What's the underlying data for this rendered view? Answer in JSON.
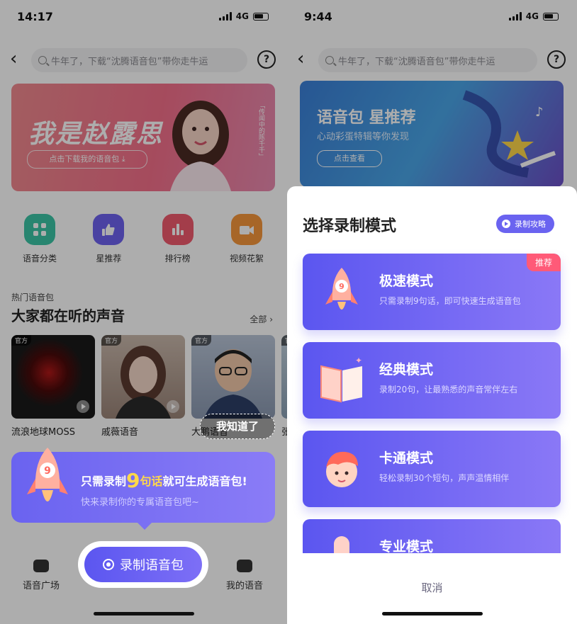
{
  "left": {
    "status": {
      "time": "14:17",
      "network": "4G"
    },
    "search_placeholder": "牛年了，下载“沈腾语音包”带你走牛运",
    "help": "?",
    "banner": {
      "title": "我是赵露思",
      "button": "点击下载我的语音包 ⤓",
      "side_text": "「传闻中的陈千千」"
    },
    "categories": [
      {
        "label": "语音分类",
        "icon": "grid-icon",
        "color": "#3cc4a6"
      },
      {
        "label": "星推荐",
        "icon": "thumbs-up-icon",
        "color": "#6e62ef"
      },
      {
        "label": "排行榜",
        "icon": "ranking-icon",
        "color": "#f05a6e"
      },
      {
        "label": "视频花絮",
        "icon": "video-icon",
        "color": "#f7973c"
      }
    ],
    "section_sub": "热门语音包",
    "section_title": "大家都在听的声音",
    "view_all": "全部 ›",
    "cards": [
      {
        "name": "流浪地球MOSS",
        "tag": "官方"
      },
      {
        "name": "戚薇语音",
        "tag": "官方"
      },
      {
        "name": "大鹏语音",
        "tag": "官方"
      },
      {
        "name": "张",
        "tag": "官方"
      }
    ],
    "i_know": "我知道了",
    "tip": {
      "pre": "只需录制",
      "num": "9",
      "mid": "句话",
      "post": "就可生成语音包!",
      "sub": "快来录制你的专属语音包吧~"
    },
    "tabs": {
      "square": "语音广场",
      "record": "录制语音包",
      "mine": "我的语音"
    }
  },
  "right": {
    "status": {
      "time": "9:44",
      "network": "4G"
    },
    "search_placeholder": "牛年了，下载“沈腾语音包”带你走牛运",
    "help": "?",
    "banner": {
      "title": "语音包 星推荐",
      "subtitle": "心动彩蛋特辑等你发现",
      "button": "点击查看"
    },
    "sheet": {
      "title": "选择录制模式",
      "guide": "录制攻略",
      "modes": [
        {
          "title": "极速模式",
          "desc": "只需录制9句话，即可快速生成语音包",
          "badge": "推荐",
          "icon": "rocket-icon"
        },
        {
          "title": "经典模式",
          "desc": "录制20句，让最熟悉的声音常伴左右",
          "badge": "",
          "icon": "book-icon"
        },
        {
          "title": "卡通模式",
          "desc": "轻松录制30个短句，声声温情相伴",
          "badge": "",
          "icon": "cartoon-face-icon"
        },
        {
          "title": "专业模式",
          "desc": "",
          "badge": "",
          "icon": "microphone-icon"
        }
      ],
      "cancel": "取消"
    }
  }
}
